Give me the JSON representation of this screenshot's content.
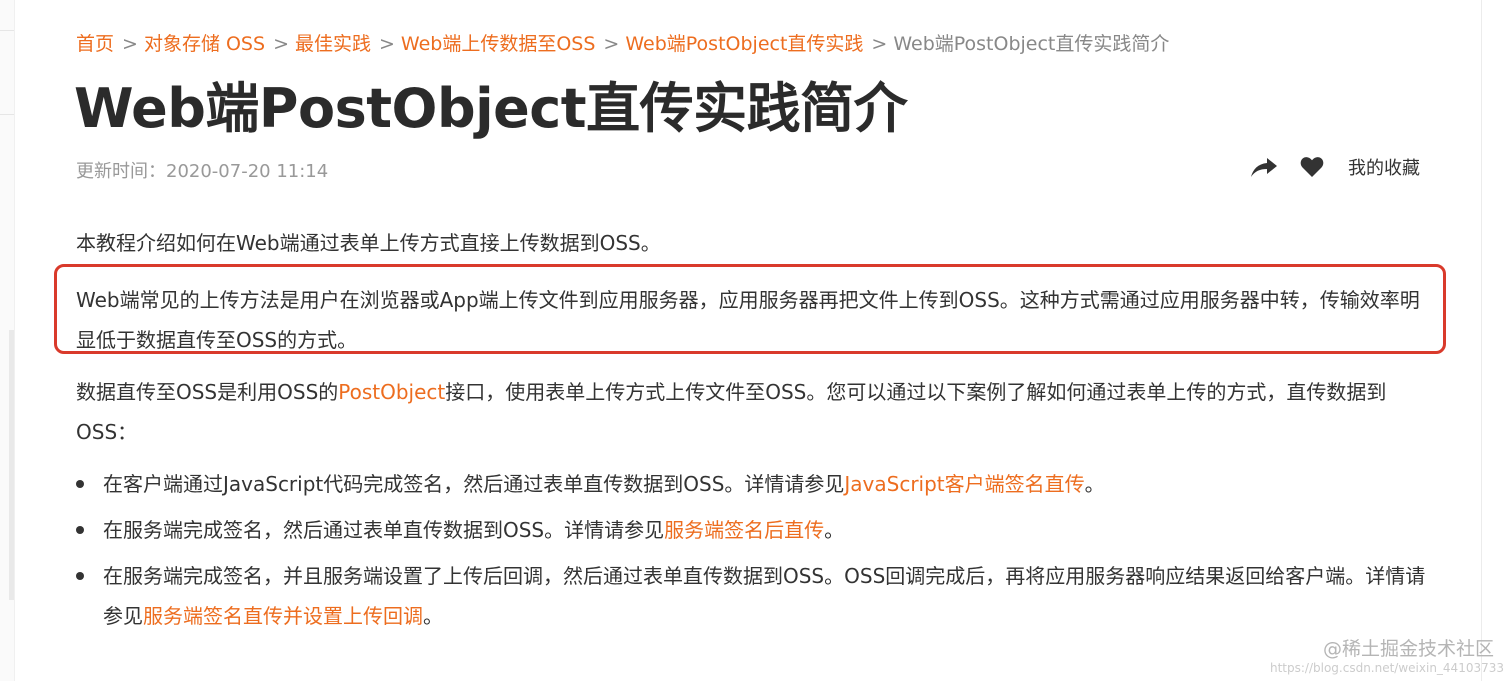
{
  "breadcrumb": {
    "items": [
      {
        "label": "首页"
      },
      {
        "label": "对象存储 OSS"
      },
      {
        "label": "最佳实践"
      },
      {
        "label": "Web端上传数据至OSS"
      },
      {
        "label": "Web端PostObject直传实践"
      }
    ],
    "separator": ">",
    "current": "Web端PostObject直传实践简介"
  },
  "title": "Web端PostObject直传实践简介",
  "meta": {
    "updated_label": "更新时间：",
    "updated_value": "2020-07-20 11:14"
  },
  "actions": {
    "share_icon": "share-arrow-icon",
    "heart_icon": "heart-icon",
    "favorites_label": "我的收藏"
  },
  "content": {
    "intro": "本教程介绍如何在Web端通过表单上传方式直接上传数据到OSS。",
    "highlighted": "Web端常见的上传方法是用户在浏览器或App端上传文件到应用服务器，应用服务器再把文件上传到OSS。这种方式需通过应用服务器中转，传输效率明显低于数据直传至OSS的方式。",
    "desc_before": "数据直传至OSS是利用OSS的",
    "desc_link": "PostObject",
    "desc_after": "接口，使用表单上传方式上传文件至OSS。您可以通过以下案例了解如何通过表单上传的方式，直传数据到OSS：",
    "bullets": [
      {
        "text": "在客户端通过JavaScript代码完成签名，然后通过表单直传数据到OSS。详情请参见",
        "link": "JavaScript客户端签名直传",
        "end": "。"
      },
      {
        "text": "在服务端完成签名，然后通过表单直传数据到OSS。详情请参见",
        "link": "服务端签名后直传",
        "end": "。"
      },
      {
        "text": "在服务端完成签名，并且服务端设置了上传后回调，然后通过表单直传数据到OSS。OSS回调完成后，再将应用服务器响应结果返回给客户端。详情请参见",
        "link": "服务端签名直传并设置上传回调",
        "end": "。"
      }
    ]
  },
  "watermark": {
    "text": "@稀土掘金技术社区",
    "url": "https://blog.csdn.net/weixin_44103733"
  },
  "colors": {
    "accent": "#ed6d1f",
    "highlight_border": "#d93a2b",
    "text": "#333333",
    "muted": "#999999"
  }
}
